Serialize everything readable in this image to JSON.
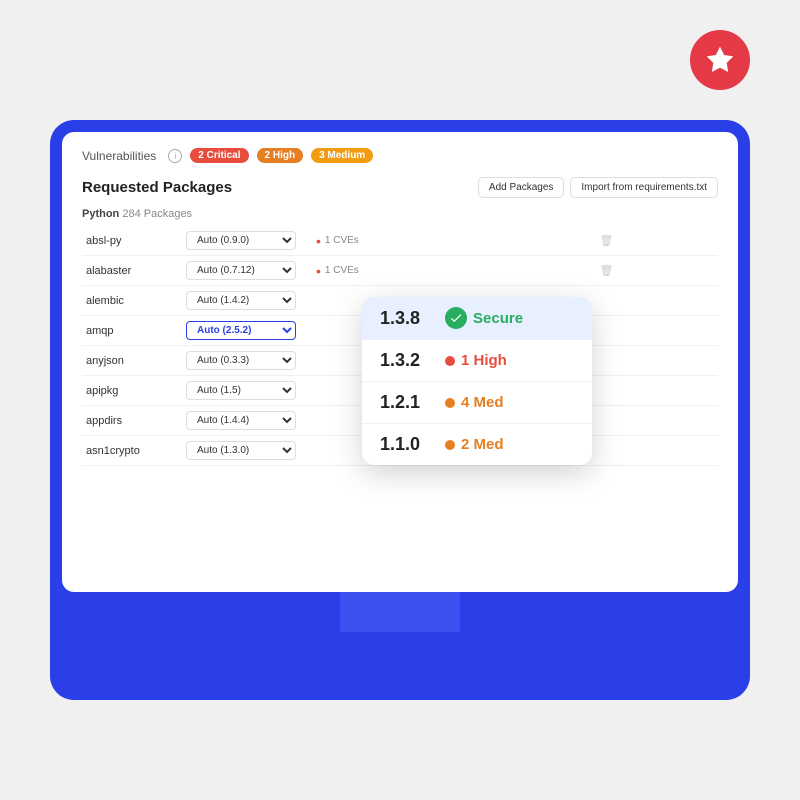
{
  "star_badge": {
    "aria": "featured-star"
  },
  "vulnerabilities": {
    "label": "Vulnerabilities",
    "badges": [
      {
        "label": "2 Critical",
        "type": "critical"
      },
      {
        "label": "2 High",
        "type": "high"
      },
      {
        "label": "3 Medium",
        "type": "medium"
      }
    ]
  },
  "requested_packages": {
    "title": "Requested Packages",
    "add_btn": "Add Packages",
    "import_btn": "Import from requirements.txt",
    "python_label": "Python",
    "package_count": "284 Packages"
  },
  "packages": [
    {
      "name": "absl-py",
      "version": "Auto (0.9.0)",
      "highlighted": false,
      "cve": "1 CVEs"
    },
    {
      "name": "alabaster",
      "version": "Auto (0.7.12)",
      "highlighted": false,
      "cve": "1 CVEs"
    },
    {
      "name": "alembic",
      "version": "Auto (1.4.2)",
      "highlighted": false,
      "cve": ""
    },
    {
      "name": "amqp",
      "version": "Auto (2.5.2)",
      "highlighted": true,
      "cve": ""
    },
    {
      "name": "anyjson",
      "version": "Auto (0.3.3)",
      "highlighted": false,
      "cve": ""
    },
    {
      "name": "apipkg",
      "version": "Auto (1.5)",
      "highlighted": false,
      "cve": ""
    },
    {
      "name": "appdirs",
      "version": "Auto (1.4.4)",
      "highlighted": false,
      "cve": ""
    },
    {
      "name": "asn1crypto",
      "version": "Auto (1.3.0)",
      "highlighted": false,
      "cve": ""
    }
  ],
  "version_dropdown": {
    "items": [
      {
        "version": "1.3.8",
        "status": "Secure",
        "type": "secure",
        "active": true
      },
      {
        "version": "1.3.2",
        "status": "1 High",
        "type": "high",
        "active": false
      },
      {
        "version": "1.2.1",
        "status": "4 Med",
        "type": "med",
        "active": false
      },
      {
        "version": "1.1.0",
        "status": "2 Med",
        "type": "med",
        "active": false
      }
    ]
  }
}
